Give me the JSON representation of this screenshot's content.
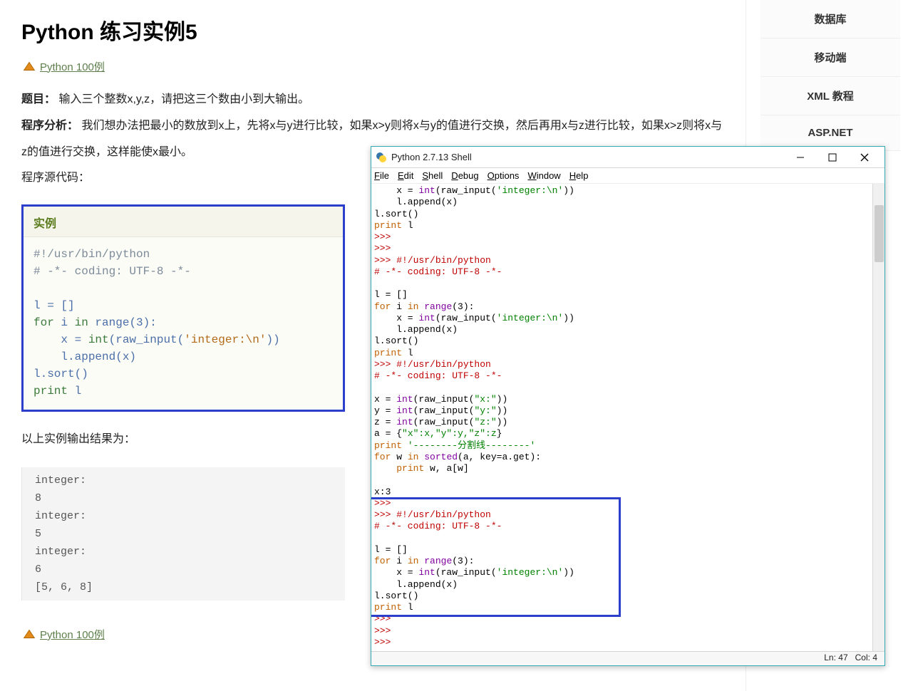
{
  "article": {
    "title": "Python 练习实例5",
    "crumb_link": "Python 100例",
    "topic_title": "题目：",
    "topic_body": "输入三个整数x,y,z，请把这三个数由小到大输出。",
    "analysis_title": "程序分析：",
    "analysis_body": "我们想办法把最小的数放到x上，先将x与y进行比较，如果x>y则将x与y的值进行交换，然后再用x与z进行比较，如果x>z则将x与z的值进行交换，这样能使x最小。",
    "source_label": "程序源代码：",
    "code_title": "实例",
    "result_label": "以上实例输出结果为：",
    "output_lines": [
      "integer:",
      "8",
      "integer:",
      "5",
      "integer:",
      "6",
      "[5, 6, 8]"
    ],
    "crumb_link2": "Python 100例",
    "code": {
      "shebang": "#!/usr/bin/python",
      "coding": "# -*- coding: UTF-8 -*-",
      "l1": "l = []",
      "l2_kw": "for",
      "l2_rest": " i ",
      "l2_in": "in",
      "l2_rng": " range(3):",
      "l3a": "    x = ",
      "l3b": "int",
      "l3c": "(raw_input(",
      "l3d": "'integer:\\n'",
      "l3e": "))",
      "l4": "    l.append(x)",
      "l5": "l.sort()",
      "l6_kw": "print",
      "l6_rest": " l"
    }
  },
  "sidebar": {
    "items": [
      "数据库",
      "移动端",
      "XML 教程",
      "ASP.NET"
    ]
  },
  "idle": {
    "title": "Python 2.7.13 Shell",
    "menus": [
      "File",
      "Edit",
      "Shell",
      "Debug",
      "Options",
      "Window",
      "Help"
    ],
    "status_ln": "Ln: 47",
    "status_col": "Col: 4",
    "code_lines": {
      "p": ">>> ",
      "shebang": "#!/usr/bin/python",
      "coding": "# -*- coding: UTF-8 -*-",
      "assign_x": "    x = int(raw_input('integer:\\n'))",
      "append": "    l.append(x)",
      "sort": "l.sort()",
      "print_l_kw": "print",
      "print_l_id": " l",
      "l_init": "l = []",
      "for_head_kw": "for",
      "for_head_mid": " i ",
      "for_head_in": "in",
      "for_head_tail": " range(3):",
      "x_int": "x = int(raw_input(\"x:\"))",
      "y_int": "y = int(raw_input(\"y:\"))",
      "z_int": "z = int(raw_input(\"z:\"))",
      "a_dict_lhs": "a = {",
      "a_dict_body": "\"x\":x,\"y\":y,\"z\":z",
      "a_dict_rhs": "}",
      "sepline_kw": "print",
      "sepline_str": " '--------分割线--------'",
      "for_sorted_kw": "for",
      "for_sorted_mid": " w ",
      "for_sorted_in": "in",
      "for_sorted_tail": " sorted(a, key=a.get):",
      "print_wa_kw1": "print",
      "print_wa_mid": " w, a[w]",
      "x3": "x:3"
    }
  }
}
